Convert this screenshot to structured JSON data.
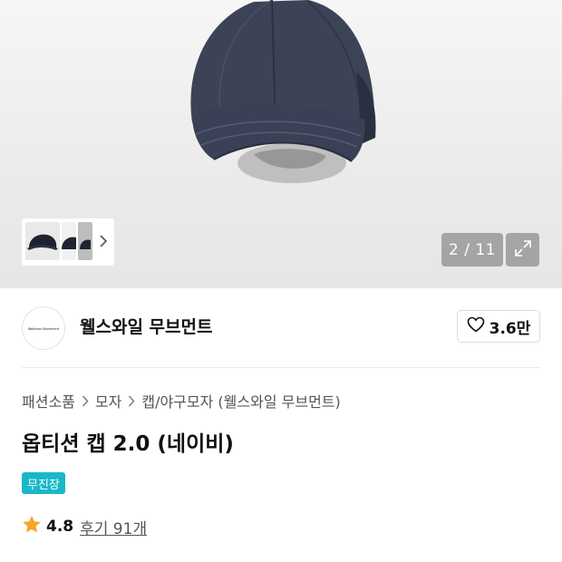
{
  "gallery": {
    "counter": "2 / 11"
  },
  "brand": {
    "logo_text": "Wellness Movement",
    "name": "웰스와일 무브먼트",
    "like_count": "3.6만"
  },
  "breadcrumb": [
    "패션소품",
    "모자",
    "캡/야구모자 (웰스와일 무브먼트)"
  ],
  "product": {
    "title": "옵티션 캡 2.0 (네이비)",
    "badge": "무진장",
    "rating": "4.8",
    "reviews": "후기 91개"
  },
  "icons": {
    "thumb_next": "chevron-right-icon",
    "expand": "expand-arrows-icon",
    "like": "heart-outline-icon",
    "rating": "star-icon",
    "breadcrumb_separator": "chevron-right-icon"
  },
  "colors": {
    "badge": "#19b8c8",
    "star": "#f5a623",
    "cap": "#3a4054"
  }
}
